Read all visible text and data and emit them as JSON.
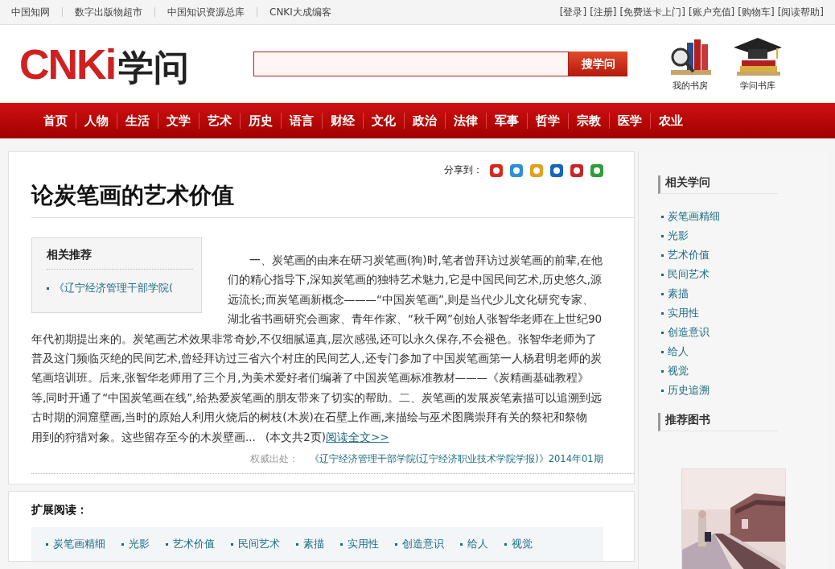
{
  "top_bar": {
    "left_links": [
      "中国知网",
      "数字出版物超市",
      "中国知识资源总库",
      "CNKI大成编客"
    ],
    "right_links": [
      "[登录]",
      "[注册]",
      "[免费送卡上门]",
      "[账户充值]",
      "[购物车]",
      "[阅读帮助]"
    ]
  },
  "header": {
    "logo": {
      "letters": "CNKi",
      "word": "学问"
    },
    "search": {
      "button": "搜学问"
    },
    "shortcuts": [
      {
        "kind": "bookshelf",
        "label": "我的书房"
      },
      {
        "kind": "cap",
        "label": "学问书库"
      }
    ]
  },
  "nav": [
    "首页",
    "人物",
    "生活",
    "文学",
    "艺术",
    "历史",
    "语言",
    "财经",
    "文化",
    "政治",
    "法律",
    "军事",
    "哲学",
    "宗教",
    "医学",
    "农业"
  ],
  "article": {
    "share_label": "分享到：",
    "share_icons": [
      {
        "color": "#d52b1e"
      },
      {
        "color": "#2f8fd8"
      },
      {
        "color": "#e0a020"
      },
      {
        "color": "#1565c0"
      },
      {
        "color": "#c62828"
      },
      {
        "color": "#2e9d3a"
      }
    ],
    "title": "论炭笔画的艺术价值",
    "recommend": {
      "title": "相关推荐",
      "items": [
        "《辽宁经济管理干部学院("
      ]
    },
    "body_beside": "一、炭笔画的由来在研习炭笔画(狗)时,笔者曾拜访过炭笔画的前辈,在他们的精心指导下,深知炭笔画的独特艺术魅力,它是中国民间艺术,历史悠久,源远流长;而炭笔画新概念———“中国炭笔画”,则是当代少儿文化研究专家、湖北省书画研究会画家、青年作家、“秋千网”创始人张智华老师在上世纪90",
    "body": "年代初期提出来的。炭笔画艺术效果非常奇妙,不仅细腻逼真,层次感强,还可以永久保存,不会褪色。张智华老师为了普及这门频临灭绝的民间艺术,曾经拜访过三省六个村庄的民间艺人,还专门参加了中国炭笔画第一人杨君明老师的炭笔画培训班。后来,张智华老师用了三个月,为美术爱好者们编著了中国炭笔画标准教材———《炭精画基础教程》等,同时开通了“中国炭笔画在线”,给热爱炭笔画的朋友带来了切实的帮助。二、炭笔画的发展炭笔素描可以追溯到远古时期的洞窟壁画,当时的原始人利用火烧后的树枝(木炭)在石壁上作画,来描绘与巫术图腾崇拜有关的祭祀和祭物",
    "body_end": "用到的狩猎对象。这些留存至今的木炭壁画...",
    "page_note": "(本文共2页)",
    "read_more": "阅读全文>>",
    "source_label": "权威出处：",
    "source": "《辽宁经济管理干部学院(辽宁经济职业技术学院学报)》2014年01期"
  },
  "extended_reading": {
    "title": "扩展阅读：",
    "tags": [
      "炭笔画精细",
      "光影",
      "艺术价值",
      "民间艺术",
      "素描",
      "实用性",
      "创造意识",
      "给人",
      "视觉"
    ]
  },
  "sidebar": {
    "related_title": "相关学问",
    "related": [
      "炭笔画精细",
      "光影",
      "艺术价值",
      "民间艺术",
      "素描",
      "实用性",
      "创造意识",
      "给人",
      "视觉",
      "历史追溯"
    ],
    "books_title": "推荐图书"
  }
}
